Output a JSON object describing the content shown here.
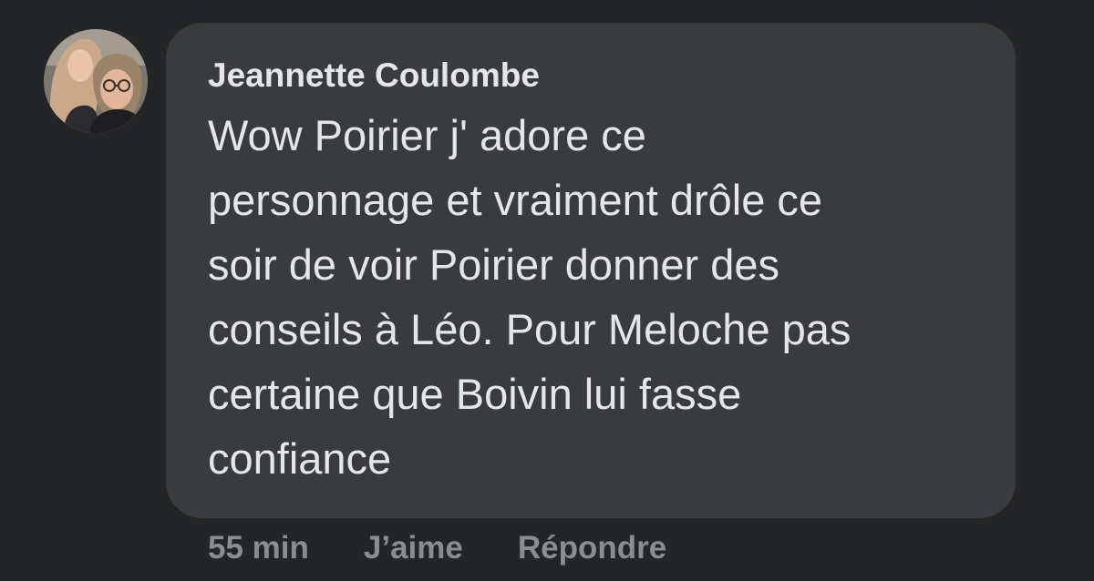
{
  "comment": {
    "author": "Jeannette Coulombe",
    "text_lines": [
      "Wow Poirier j' adore ce",
      "personnage et vraiment drôle ce",
      "soir de voir Poirier donner des",
      "conseils à Léo. Pour Meloche pas",
      "certaine que Boivin lui fasse",
      "confiance"
    ],
    "timestamp": "55 min",
    "like_label": "J’aime",
    "reply_label": "Répondre"
  },
  "colors": {
    "background": "#242526",
    "bubble": "#3a3b3c",
    "text": "#e4e6eb",
    "secondary_text": "#8a8d91"
  }
}
